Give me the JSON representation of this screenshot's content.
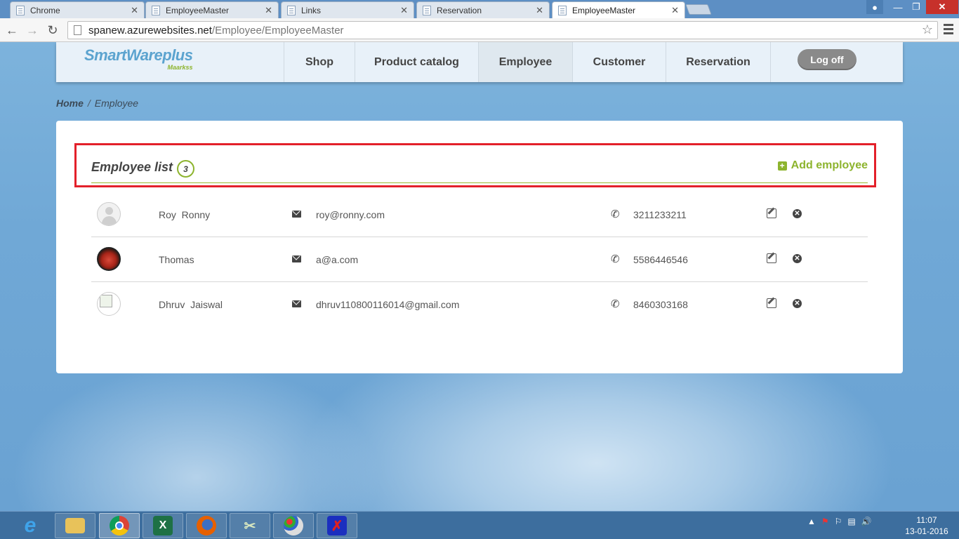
{
  "browser": {
    "tabs": [
      {
        "title": "Chrome",
        "active": false
      },
      {
        "title": "EmployeeMaster",
        "active": false
      },
      {
        "title": "Links",
        "active": false
      },
      {
        "title": "Reservation",
        "active": false
      },
      {
        "title": "EmployeeMaster",
        "active": true
      }
    ],
    "url_host": "spanew.azurewebsites.net",
    "url_path": "/Employee/EmployeeMaster"
  },
  "site": {
    "logo_main": "SmartWareplus",
    "logo_sub": "Maarkss",
    "nav": [
      {
        "label": "Shop",
        "active": false
      },
      {
        "label": "Product catalog",
        "active": false
      },
      {
        "label": "Employee",
        "active": true
      },
      {
        "label": "Customer",
        "active": false
      },
      {
        "label": "Reservation",
        "active": false
      }
    ],
    "logoff_label": "Log off"
  },
  "breadcrumb": {
    "home": "Home",
    "separator": "/",
    "current": "Employee"
  },
  "employees": {
    "title": "Employee list",
    "count": "3",
    "add_label": "Add employee",
    "rows": [
      {
        "name": "Roy  Ronny",
        "email": "roy@ronny.com",
        "phone": "3211233211",
        "avatar": "default-avatar"
      },
      {
        "name": "Thomas",
        "email": "a@a.com",
        "phone": "5586446546",
        "avatar": "photo-avatar"
      },
      {
        "name": "Dhruv  Jaiswal",
        "email": "dhruv110800116014@gmail.com",
        "phone": "8460303168",
        "avatar": "broken-image-avatar"
      }
    ]
  },
  "taskbar": {
    "time": "11:07",
    "date": "13-01-2016"
  },
  "colors": {
    "accent_green": "#8db42e",
    "logo_blue": "#5ba3cf",
    "highlight_red": "#e3202a"
  }
}
